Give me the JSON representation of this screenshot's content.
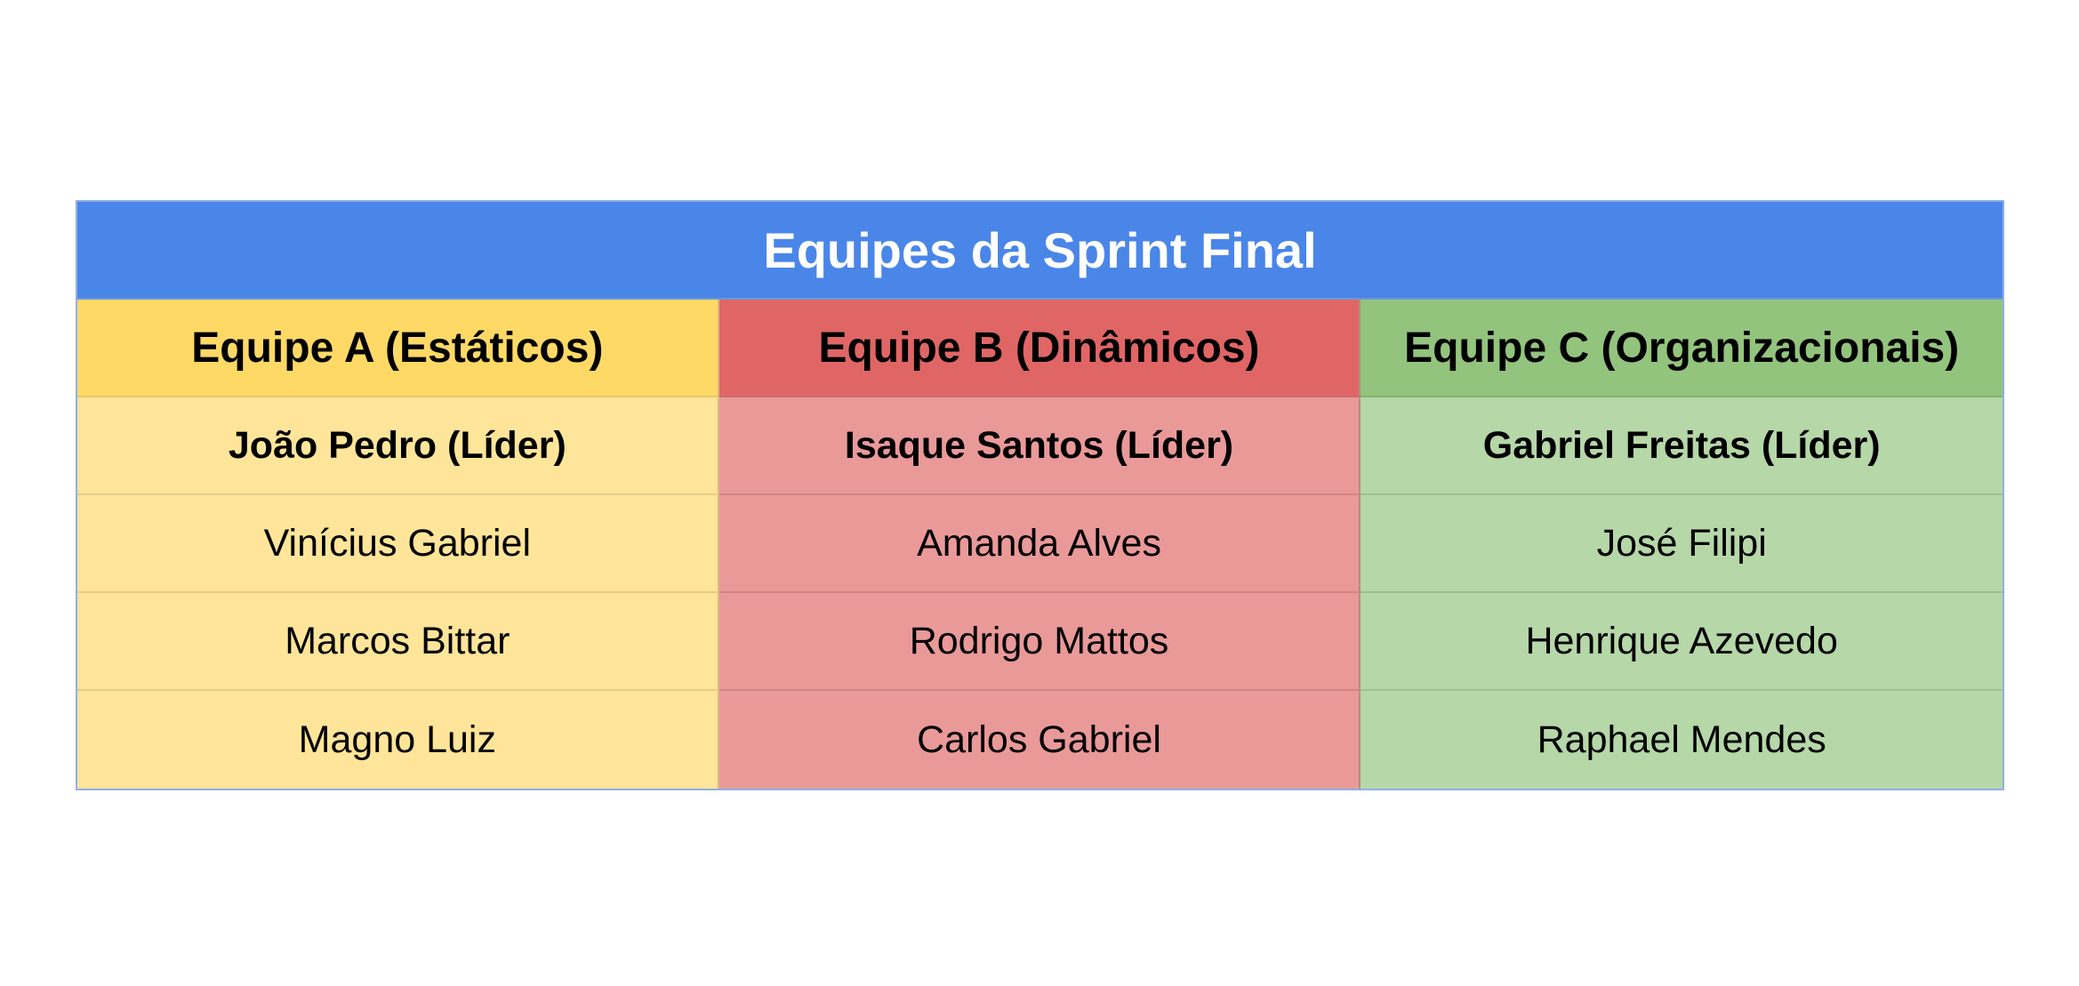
{
  "title": "Equipes da Sprint Final",
  "colors": {
    "title_bg": "#4a86e8",
    "team_a_header": "#ffd966",
    "team_a_cell": "#ffe599",
    "team_b_header": "#e06666",
    "team_b_cell": "#ea9999",
    "team_c_header": "#93c47d",
    "team_c_cell": "#b6d7a8"
  },
  "teams": [
    {
      "header": "Equipe A (Estáticos)",
      "leader": "João Pedro (Líder)",
      "members": [
        "Vinícius Gabriel",
        "Marcos Bittar",
        "Magno Luiz"
      ]
    },
    {
      "header": "Equipe B (Dinâmicos)",
      "leader": "Isaque Santos (Líder)",
      "members": [
        "Amanda Alves",
        "Rodrigo Mattos",
        "Carlos Gabriel"
      ]
    },
    {
      "header": "Equipe C (Organizacionais)",
      "leader": "Gabriel Freitas (Líder)",
      "members": [
        "José Filipi",
        "Henrique Azevedo",
        "Raphael Mendes"
      ]
    }
  ]
}
